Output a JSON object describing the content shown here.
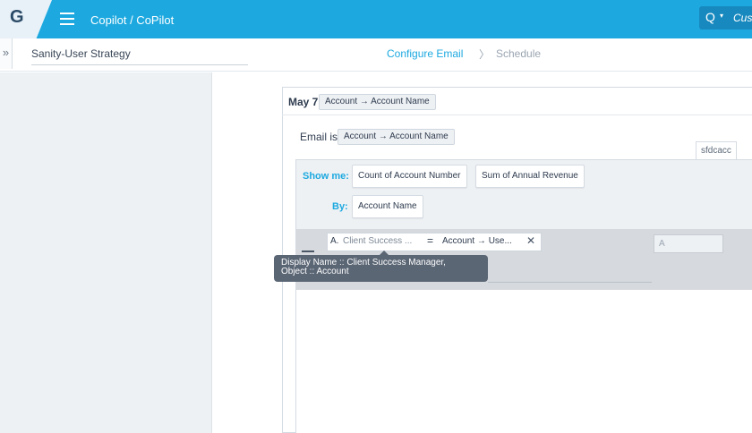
{
  "topbar": {
    "logo": "G",
    "title": "Copilot / CoPilot",
    "search_glyph": "Q",
    "search_caret": "▾",
    "search_label": "Cus",
    "menu_icon": "hamburger-icon"
  },
  "subheader": {
    "expand_glyph": "»",
    "strategy_name": "Sanity-User Strategy",
    "steps": [
      {
        "label": "Configure Email",
        "active": true
      },
      {
        "label": "Schedule",
        "active": false
      }
    ],
    "separator": "〉"
  },
  "card": {
    "date_label": "May 7",
    "date_pill": "Account → Account Name",
    "email_label": "Email is",
    "email_pill": "Account → Account Name",
    "source_tag": "sfdcacc"
  },
  "query": {
    "show_label": "Show me:",
    "show_fields": [
      "Count of Account Number",
      "Sum of Annual Revenue"
    ],
    "by_label": "By:",
    "by_fields": [
      "Account Name"
    ],
    "filter": {
      "letter": "A.",
      "field": "Client Success ...",
      "operator": "=",
      "value": "Account → Use...",
      "close": "✕",
      "logic": "A"
    }
  },
  "tooltip": {
    "line1": "Display Name :: Client Success Manager,",
    "line2": "Object :: Account"
  },
  "colors": {
    "brand": "#1da9e0",
    "panel": "#eef1f4",
    "tooltip": "#5b6675"
  }
}
